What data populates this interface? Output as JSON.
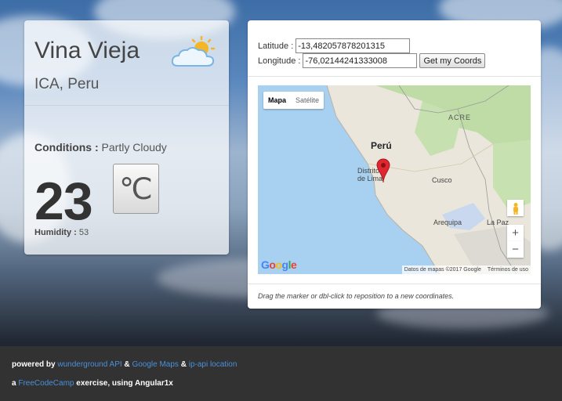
{
  "weather": {
    "city": "Vina Vieja",
    "region": "ICA, Peru",
    "icon": "partly-cloudy-icon",
    "conditions_label": "Conditions :",
    "conditions_value": "Partly Cloudy",
    "temperature": "23",
    "unit_button": "℃",
    "humidity_label": "Humidity :",
    "humidity_value": "53"
  },
  "coords": {
    "latitude_label": "Latitude :",
    "latitude_value": "-13,482057878201315",
    "longitude_label": "Longitude :",
    "longitude_value": "-76,02144241333008",
    "get_button": "Get my Coords"
  },
  "map": {
    "type_map": "Mapa",
    "type_satellite": "Satélite",
    "labels": {
      "acre": "ACRE",
      "peru": "Perú",
      "lima1": "Distrito",
      "lima2": "de Lima",
      "cusco": "Cusco",
      "arequipa": "Arequipa",
      "lapaz": "La Paz"
    },
    "zoom_in": "+",
    "zoom_out": "−",
    "google": "Google",
    "attribution": "Datos de mapas ©2017 Google",
    "terms": "Términos de uso",
    "hint": "Drag the marker or dbl-click to reposition to a new coordinates."
  },
  "footer": {
    "powered_by": "powered by",
    "wunderground": "wunderground API",
    "amp1": "&",
    "google_maps": "Google Maps",
    "amp2": "&",
    "ipapi": "ip-api location",
    "prefix": "a",
    "freecodecamp": "FreeCodeCamp",
    "suffix": "exercise, using Angular1x"
  },
  "colors": {
    "link": "#4a90d9",
    "footer_bg": "#323232",
    "marker": "#e0262f"
  }
}
